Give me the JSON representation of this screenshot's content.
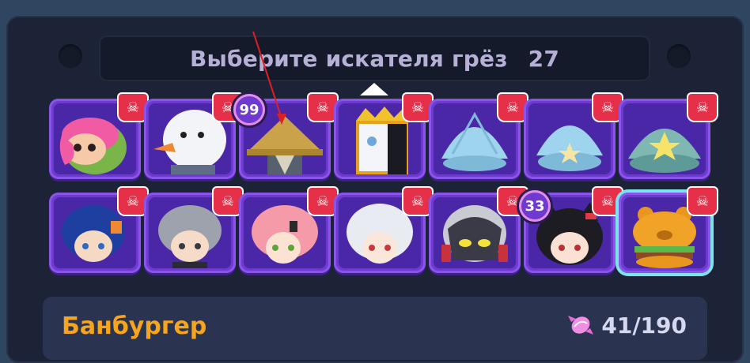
{
  "title": {
    "text": "Выберите искателя грёз",
    "count": "27"
  },
  "slots": [
    {
      "icon": "pink-slime-hero-icon",
      "skull": "☠"
    },
    {
      "icon": "snowman-duck-hero-icon",
      "skull": "☠"
    },
    {
      "icon": "straw-hat-hero-icon",
      "skull": "☠",
      "badge": "99"
    },
    {
      "icon": "crowned-mask-hero-icon",
      "skull": "☠"
    },
    {
      "icon": "clam-shell-hero-icon",
      "skull": "☠"
    },
    {
      "icon": "clam-starfish-hero-icon",
      "skull": "☠"
    },
    {
      "icon": "clam-star-baby-hero-icon",
      "skull": "☠"
    },
    {
      "icon": "blue-hair-hero-icon",
      "skull": "☠"
    },
    {
      "icon": "gray-hair-hero-icon",
      "skull": "☠"
    },
    {
      "icon": "pink-hair-hero-icon",
      "skull": "☠"
    },
    {
      "icon": "white-hair-hero-icon",
      "skull": "☠"
    },
    {
      "icon": "dark-knight-hero-icon",
      "skull": "☠"
    },
    {
      "icon": "cat-ears-girl-hero-icon",
      "skull": "☠",
      "badge": "33"
    },
    {
      "icon": "banburger-hero-icon",
      "skull": "☠",
      "selected": true
    }
  ],
  "selected_hero": {
    "name": "Банбургер",
    "progress": "41/190",
    "currency_icon": "candy-icon"
  },
  "colors": {
    "slot": "#6e3ad0",
    "skull_flag": "#e6304a",
    "selected_outline": "#7de3ee",
    "hero_name": "#f7a51c"
  }
}
